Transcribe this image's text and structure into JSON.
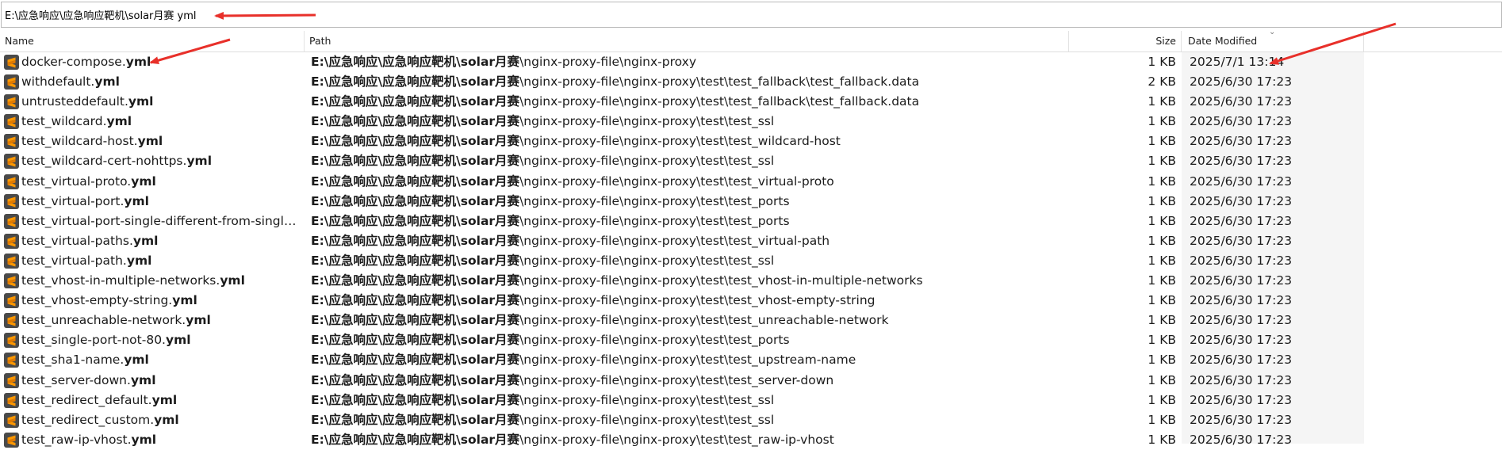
{
  "search": {
    "value": "E:\\应急响应\\应急响应靶机\\solar月赛 yml"
  },
  "columns": {
    "name": "Name",
    "path": "Path",
    "size": "Size",
    "date": "Date Modified"
  },
  "icon": "sublime-text-file-icon",
  "rows": [
    {
      "stem": "docker-compose.",
      "ext": "yml",
      "path_bold": "E:\\应急响应\\应急响应靶机\\solar月赛",
      "path_rest": "\\nginx-proxy-file\\nginx-proxy",
      "size": "1 KB",
      "date": "2025/7/1 13:14"
    },
    {
      "stem": "withdefault.",
      "ext": "yml",
      "path_bold": "E:\\应急响应\\应急响应靶机\\solar月赛",
      "path_rest": "\\nginx-proxy-file\\nginx-proxy\\test\\test_fallback\\test_fallback.data",
      "size": "2 KB",
      "date": "2025/6/30 17:23"
    },
    {
      "stem": "untrusteddefault.",
      "ext": "yml",
      "path_bold": "E:\\应急响应\\应急响应靶机\\solar月赛",
      "path_rest": "\\nginx-proxy-file\\nginx-proxy\\test\\test_fallback\\test_fallback.data",
      "size": "1 KB",
      "date": "2025/6/30 17:23"
    },
    {
      "stem": "test_wildcard.",
      "ext": "yml",
      "path_bold": "E:\\应急响应\\应急响应靶机\\solar月赛",
      "path_rest": "\\nginx-proxy-file\\nginx-proxy\\test\\test_ssl",
      "size": "1 KB",
      "date": "2025/6/30 17:23"
    },
    {
      "stem": "test_wildcard-host.",
      "ext": "yml",
      "path_bold": "E:\\应急响应\\应急响应靶机\\solar月赛",
      "path_rest": "\\nginx-proxy-file\\nginx-proxy\\test\\test_wildcard-host",
      "size": "1 KB",
      "date": "2025/6/30 17:23"
    },
    {
      "stem": "test_wildcard-cert-nohttps.",
      "ext": "yml",
      "path_bold": "E:\\应急响应\\应急响应靶机\\solar月赛",
      "path_rest": "\\nginx-proxy-file\\nginx-proxy\\test\\test_ssl",
      "size": "1 KB",
      "date": "2025/6/30 17:23"
    },
    {
      "stem": "test_virtual-proto.",
      "ext": "yml",
      "path_bold": "E:\\应急响应\\应急响应靶机\\solar月赛",
      "path_rest": "\\nginx-proxy-file\\nginx-proxy\\test\\test_virtual-proto",
      "size": "1 KB",
      "date": "2025/6/30 17:23"
    },
    {
      "stem": "test_virtual-port.",
      "ext": "yml",
      "path_bold": "E:\\应急响应\\应急响应靶机\\solar月赛",
      "path_rest": "\\nginx-proxy-file\\nginx-proxy\\test\\test_ports",
      "size": "1 KB",
      "date": "2025/6/30 17:23"
    },
    {
      "stem": "test_virtual-port-single-different-from-single-p...",
      "ext": "",
      "path_bold": "E:\\应急响应\\应急响应靶机\\solar月赛",
      "path_rest": "\\nginx-proxy-file\\nginx-proxy\\test\\test_ports",
      "size": "1 KB",
      "date": "2025/6/30 17:23"
    },
    {
      "stem": "test_virtual-paths.",
      "ext": "yml",
      "path_bold": "E:\\应急响应\\应急响应靶机\\solar月赛",
      "path_rest": "\\nginx-proxy-file\\nginx-proxy\\test\\test_virtual-path",
      "size": "1 KB",
      "date": "2025/6/30 17:23"
    },
    {
      "stem": "test_virtual-path.",
      "ext": "yml",
      "path_bold": "E:\\应急响应\\应急响应靶机\\solar月赛",
      "path_rest": "\\nginx-proxy-file\\nginx-proxy\\test\\test_ssl",
      "size": "1 KB",
      "date": "2025/6/30 17:23"
    },
    {
      "stem": "test_vhost-in-multiple-networks.",
      "ext": "yml",
      "path_bold": "E:\\应急响应\\应急响应靶机\\solar月赛",
      "path_rest": "\\nginx-proxy-file\\nginx-proxy\\test\\test_vhost-in-multiple-networks",
      "size": "1 KB",
      "date": "2025/6/30 17:23"
    },
    {
      "stem": "test_vhost-empty-string.",
      "ext": "yml",
      "path_bold": "E:\\应急响应\\应急响应靶机\\solar月赛",
      "path_rest": "\\nginx-proxy-file\\nginx-proxy\\test\\test_vhost-empty-string",
      "size": "1 KB",
      "date": "2025/6/30 17:23"
    },
    {
      "stem": "test_unreachable-network.",
      "ext": "yml",
      "path_bold": "E:\\应急响应\\应急响应靶机\\solar月赛",
      "path_rest": "\\nginx-proxy-file\\nginx-proxy\\test\\test_unreachable-network",
      "size": "1 KB",
      "date": "2025/6/30 17:23"
    },
    {
      "stem": "test_single-port-not-80.",
      "ext": "yml",
      "path_bold": "E:\\应急响应\\应急响应靶机\\solar月赛",
      "path_rest": "\\nginx-proxy-file\\nginx-proxy\\test\\test_ports",
      "size": "1 KB",
      "date": "2025/6/30 17:23"
    },
    {
      "stem": "test_sha1-name.",
      "ext": "yml",
      "path_bold": "E:\\应急响应\\应急响应靶机\\solar月赛",
      "path_rest": "\\nginx-proxy-file\\nginx-proxy\\test\\test_upstream-name",
      "size": "1 KB",
      "date": "2025/6/30 17:23"
    },
    {
      "stem": "test_server-down.",
      "ext": "yml",
      "path_bold": "E:\\应急响应\\应急响应靶机\\solar月赛",
      "path_rest": "\\nginx-proxy-file\\nginx-proxy\\test\\test_server-down",
      "size": "1 KB",
      "date": "2025/6/30 17:23"
    },
    {
      "stem": "test_redirect_default.",
      "ext": "yml",
      "path_bold": "E:\\应急响应\\应急响应靶机\\solar月赛",
      "path_rest": "\\nginx-proxy-file\\nginx-proxy\\test\\test_ssl",
      "size": "1 KB",
      "date": "2025/6/30 17:23"
    },
    {
      "stem": "test_redirect_custom.",
      "ext": "yml",
      "path_bold": "E:\\应急响应\\应急响应靶机\\solar月赛",
      "path_rest": "\\nginx-proxy-file\\nginx-proxy\\test\\test_ssl",
      "size": "1 KB",
      "date": "2025/6/30 17:23"
    },
    {
      "stem": "test_raw-ip-vhost.",
      "ext": "yml",
      "path_bold": "E:\\应急响应\\应急响应靶机\\solar月赛",
      "path_rest": "\\nginx-proxy-file\\nginx-proxy\\test\\test_raw-ip-vhost",
      "size": "1 KB",
      "date": "2025/6/30 17:23"
    }
  ],
  "colors": {
    "arrow": "#e8302a",
    "icon_bg": "#4a4a4a",
    "icon_fg": "#ff9800"
  }
}
